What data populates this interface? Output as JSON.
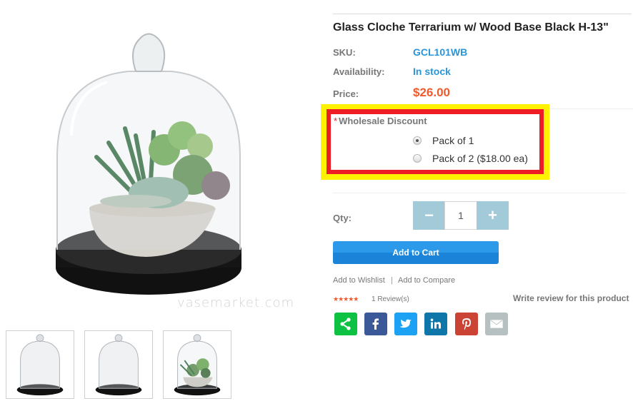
{
  "product": {
    "title": "Glass Cloche Terrarium w/ Wood Base Black H-13\"",
    "sku_label": "SKU:",
    "sku_value": "GCL101WB",
    "availability_label": "Availability:",
    "availability_value": "In stock",
    "price_label": "Price:",
    "price_value": "$26.00"
  },
  "gallery": {
    "watermark": "vasemarket.com",
    "thumbnails": [
      {
        "alt": "Empty glass cloche on black base"
      },
      {
        "alt": "Empty glass cloche on black base"
      },
      {
        "alt": "Glass cloche with succulents"
      }
    ]
  },
  "wholesale": {
    "required_mark": "*",
    "label": "Wholesale Discount",
    "options": [
      {
        "label": "Pack of 1",
        "selected": true
      },
      {
        "label": "Pack of 2 ($18.00 ea)",
        "selected": false
      }
    ]
  },
  "quantity": {
    "label": "Qty:",
    "minus": "−",
    "plus": "+",
    "value": "1"
  },
  "actions": {
    "add_to_cart": "Add to Cart",
    "add_to_wishlist": "Add to Wishlist",
    "separator": "|",
    "add_to_compare": "Add to Compare"
  },
  "reviews": {
    "stars": "★★★★★",
    "rating": 5,
    "count_text": "1 Review(s)",
    "write_review": "Write review for this product"
  },
  "share": [
    {
      "name": "share",
      "color": "#0dc143"
    },
    {
      "name": "facebook",
      "color": "#3b5998"
    },
    {
      "name": "twitter",
      "color": "#1da1f2"
    },
    {
      "name": "linkedin",
      "color": "#0e76a8"
    },
    {
      "name": "pinterest",
      "color": "#cb4335"
    },
    {
      "name": "email",
      "color": "#b7c0c0"
    }
  ],
  "colors": {
    "link_blue": "#2a95d8",
    "price_orange": "#f05a2c",
    "highlight_yellow": "#fff200",
    "highlight_red": "#ee1c25",
    "qty_button": "#a2cad8",
    "cart_button": "#2c9ae9"
  }
}
